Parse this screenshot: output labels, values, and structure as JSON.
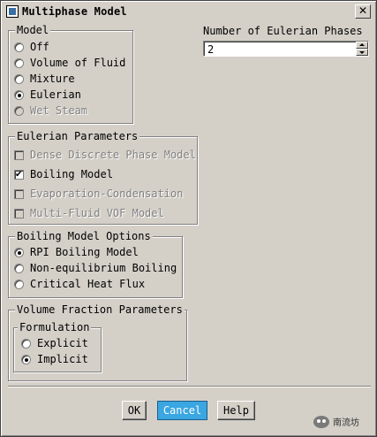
{
  "window": {
    "title": "Multiphase Model",
    "close_glyph": "✕"
  },
  "model": {
    "legend": "Model",
    "options": [
      {
        "label": "Off",
        "checked": false,
        "disabled": false
      },
      {
        "label": "Volume of Fluid",
        "checked": false,
        "disabled": false
      },
      {
        "label": "Mixture",
        "checked": false,
        "disabled": false
      },
      {
        "label": "Eulerian",
        "checked": true,
        "disabled": false
      },
      {
        "label": "Wet Steam",
        "checked": false,
        "disabled": true
      }
    ]
  },
  "phases": {
    "label": "Number of Eulerian Phases",
    "value": "2"
  },
  "eulerian_parameters": {
    "legend": "Eulerian Parameters",
    "options": [
      {
        "label": "Dense Discrete Phase Model",
        "checked": false,
        "disabled": true
      },
      {
        "label": "Boiling Model",
        "checked": true,
        "disabled": false
      },
      {
        "label": "Evaporation-Condensation",
        "checked": false,
        "disabled": true
      },
      {
        "label": "Multi-Fluid VOF Model",
        "checked": false,
        "disabled": true
      }
    ]
  },
  "boiling_options": {
    "legend": "Boiling Model Options",
    "options": [
      {
        "label": "RPI Boiling Model",
        "checked": true
      },
      {
        "label": "Non-equilibrium Boiling",
        "checked": false
      },
      {
        "label": "Critical Heat Flux",
        "checked": false
      }
    ]
  },
  "volume_fraction": {
    "legend": "Volume Fraction Parameters",
    "formulation": {
      "legend": "Formulation",
      "options": [
        {
          "label": "Explicit",
          "checked": false
        },
        {
          "label": "Implicit",
          "checked": true
        }
      ]
    }
  },
  "buttons": {
    "ok": "OK",
    "cancel": "Cancel",
    "help": "Help"
  },
  "watermark": {
    "text": "南流坊",
    "icon": "wechat-icon"
  },
  "colors": {
    "face": "#d4d0c8",
    "active_button": "#3aa6e2"
  }
}
